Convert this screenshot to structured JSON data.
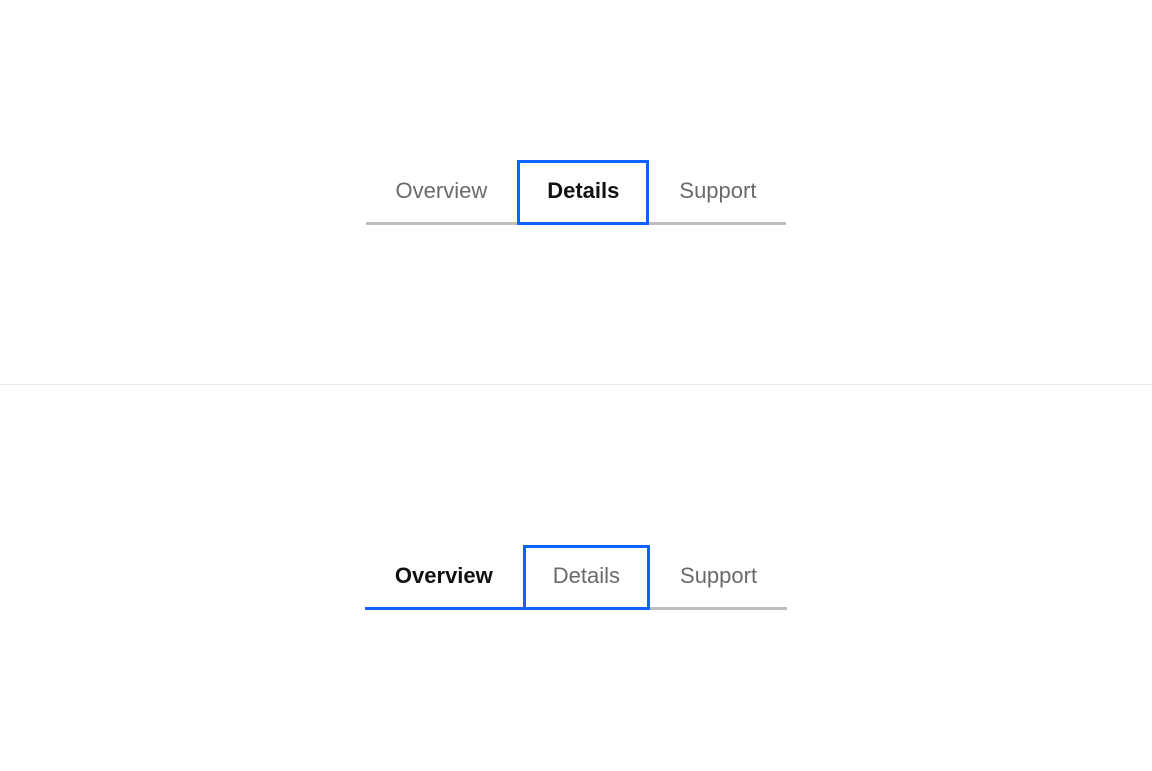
{
  "example1": {
    "tabs": [
      {
        "label": "Overview"
      },
      {
        "label": "Details"
      },
      {
        "label": "Support"
      }
    ]
  },
  "example2": {
    "tabs": [
      {
        "label": "Overview"
      },
      {
        "label": "Details"
      },
      {
        "label": "Support"
      }
    ]
  }
}
